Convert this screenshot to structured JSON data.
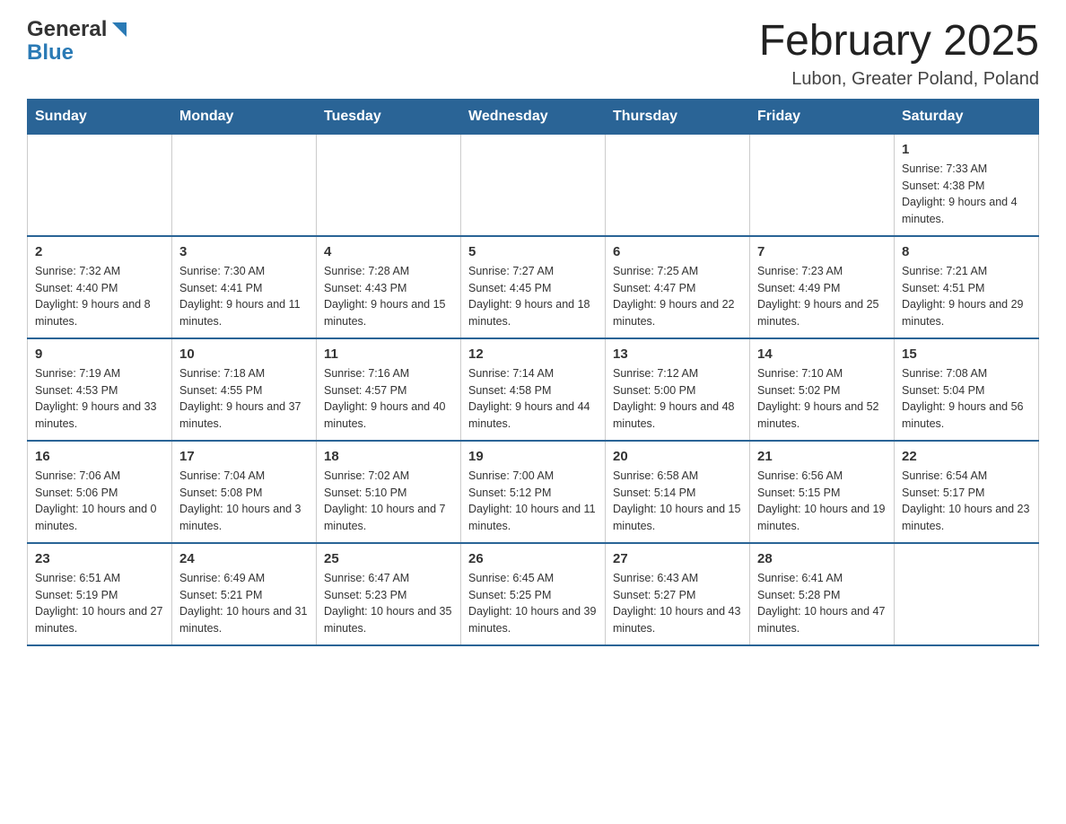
{
  "logo": {
    "general": "General",
    "blue": "Blue"
  },
  "title": "February 2025",
  "subtitle": "Lubon, Greater Poland, Poland",
  "weekdays": [
    "Sunday",
    "Monday",
    "Tuesday",
    "Wednesday",
    "Thursday",
    "Friday",
    "Saturday"
  ],
  "weeks": [
    [
      {
        "day": "",
        "info": ""
      },
      {
        "day": "",
        "info": ""
      },
      {
        "day": "",
        "info": ""
      },
      {
        "day": "",
        "info": ""
      },
      {
        "day": "",
        "info": ""
      },
      {
        "day": "",
        "info": ""
      },
      {
        "day": "1",
        "info": "Sunrise: 7:33 AM\nSunset: 4:38 PM\nDaylight: 9 hours and 4 minutes."
      }
    ],
    [
      {
        "day": "2",
        "info": "Sunrise: 7:32 AM\nSunset: 4:40 PM\nDaylight: 9 hours and 8 minutes."
      },
      {
        "day": "3",
        "info": "Sunrise: 7:30 AM\nSunset: 4:41 PM\nDaylight: 9 hours and 11 minutes."
      },
      {
        "day": "4",
        "info": "Sunrise: 7:28 AM\nSunset: 4:43 PM\nDaylight: 9 hours and 15 minutes."
      },
      {
        "day": "5",
        "info": "Sunrise: 7:27 AM\nSunset: 4:45 PM\nDaylight: 9 hours and 18 minutes."
      },
      {
        "day": "6",
        "info": "Sunrise: 7:25 AM\nSunset: 4:47 PM\nDaylight: 9 hours and 22 minutes."
      },
      {
        "day": "7",
        "info": "Sunrise: 7:23 AM\nSunset: 4:49 PM\nDaylight: 9 hours and 25 minutes."
      },
      {
        "day": "8",
        "info": "Sunrise: 7:21 AM\nSunset: 4:51 PM\nDaylight: 9 hours and 29 minutes."
      }
    ],
    [
      {
        "day": "9",
        "info": "Sunrise: 7:19 AM\nSunset: 4:53 PM\nDaylight: 9 hours and 33 minutes."
      },
      {
        "day": "10",
        "info": "Sunrise: 7:18 AM\nSunset: 4:55 PM\nDaylight: 9 hours and 37 minutes."
      },
      {
        "day": "11",
        "info": "Sunrise: 7:16 AM\nSunset: 4:57 PM\nDaylight: 9 hours and 40 minutes."
      },
      {
        "day": "12",
        "info": "Sunrise: 7:14 AM\nSunset: 4:58 PM\nDaylight: 9 hours and 44 minutes."
      },
      {
        "day": "13",
        "info": "Sunrise: 7:12 AM\nSunset: 5:00 PM\nDaylight: 9 hours and 48 minutes."
      },
      {
        "day": "14",
        "info": "Sunrise: 7:10 AM\nSunset: 5:02 PM\nDaylight: 9 hours and 52 minutes."
      },
      {
        "day": "15",
        "info": "Sunrise: 7:08 AM\nSunset: 5:04 PM\nDaylight: 9 hours and 56 minutes."
      }
    ],
    [
      {
        "day": "16",
        "info": "Sunrise: 7:06 AM\nSunset: 5:06 PM\nDaylight: 10 hours and 0 minutes."
      },
      {
        "day": "17",
        "info": "Sunrise: 7:04 AM\nSunset: 5:08 PM\nDaylight: 10 hours and 3 minutes."
      },
      {
        "day": "18",
        "info": "Sunrise: 7:02 AM\nSunset: 5:10 PM\nDaylight: 10 hours and 7 minutes."
      },
      {
        "day": "19",
        "info": "Sunrise: 7:00 AM\nSunset: 5:12 PM\nDaylight: 10 hours and 11 minutes."
      },
      {
        "day": "20",
        "info": "Sunrise: 6:58 AM\nSunset: 5:14 PM\nDaylight: 10 hours and 15 minutes."
      },
      {
        "day": "21",
        "info": "Sunrise: 6:56 AM\nSunset: 5:15 PM\nDaylight: 10 hours and 19 minutes."
      },
      {
        "day": "22",
        "info": "Sunrise: 6:54 AM\nSunset: 5:17 PM\nDaylight: 10 hours and 23 minutes."
      }
    ],
    [
      {
        "day": "23",
        "info": "Sunrise: 6:51 AM\nSunset: 5:19 PM\nDaylight: 10 hours and 27 minutes."
      },
      {
        "day": "24",
        "info": "Sunrise: 6:49 AM\nSunset: 5:21 PM\nDaylight: 10 hours and 31 minutes."
      },
      {
        "day": "25",
        "info": "Sunrise: 6:47 AM\nSunset: 5:23 PM\nDaylight: 10 hours and 35 minutes."
      },
      {
        "day": "26",
        "info": "Sunrise: 6:45 AM\nSunset: 5:25 PM\nDaylight: 10 hours and 39 minutes."
      },
      {
        "day": "27",
        "info": "Sunrise: 6:43 AM\nSunset: 5:27 PM\nDaylight: 10 hours and 43 minutes."
      },
      {
        "day": "28",
        "info": "Sunrise: 6:41 AM\nSunset: 5:28 PM\nDaylight: 10 hours and 47 minutes."
      },
      {
        "day": "",
        "info": ""
      }
    ]
  ]
}
